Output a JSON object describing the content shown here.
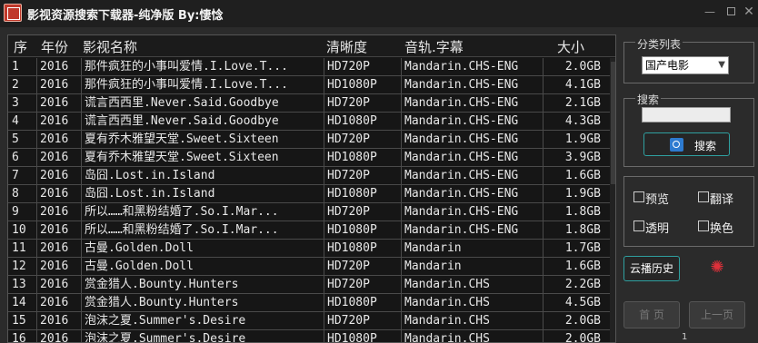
{
  "window": {
    "title": "影视资源搜索下载器-纯净版 By:悽惗",
    "minimize_label": "—",
    "close_label": "✕"
  },
  "table": {
    "headers": [
      "序",
      "年份",
      "影视名称",
      "清晰度",
      "音轨.字幕",
      "大小"
    ],
    "rows": [
      [
        "1",
        "2016",
        "那件疯狂的小事叫爱情.I.Love.T...",
        "HD720P",
        "Mandarin.CHS-ENG",
        "2.0GB"
      ],
      [
        "2",
        "2016",
        "那件疯狂的小事叫爱情.I.Love.T...",
        "HD1080P",
        "Mandarin.CHS-ENG",
        "4.1GB"
      ],
      [
        "3",
        "2016",
        "谎言西西里.Never.Said.Goodbye",
        "HD720P",
        "Mandarin.CHS-ENG",
        "2.1GB"
      ],
      [
        "4",
        "2016",
        "谎言西西里.Never.Said.Goodbye",
        "HD1080P",
        "Mandarin.CHS-ENG",
        "4.3GB"
      ],
      [
        "5",
        "2016",
        "夏有乔木雅望天堂.Sweet.Sixteen",
        "HD720P",
        "Mandarin.CHS-ENG",
        "1.9GB"
      ],
      [
        "6",
        "2016",
        "夏有乔木雅望天堂.Sweet.Sixteen",
        "HD1080P",
        "Mandarin.CHS-ENG",
        "3.9GB"
      ],
      [
        "7",
        "2016",
        "岛囧.Lost.in.Island",
        "HD720P",
        "Mandarin.CHS-ENG",
        "1.6GB"
      ],
      [
        "8",
        "2016",
        "岛囧.Lost.in.Island",
        "HD1080P",
        "Mandarin.CHS-ENG",
        "1.9GB"
      ],
      [
        "9",
        "2016",
        "所以……和黑粉结婚了.So.I.Mar...",
        "HD720P",
        "Mandarin.CHS-ENG",
        "1.8GB"
      ],
      [
        "10",
        "2016",
        "所以……和黑粉结婚了.So.I.Mar...",
        "HD1080P",
        "Mandarin.CHS-ENG",
        "1.8GB"
      ],
      [
        "11",
        "2016",
        "古曼.Golden.Doll",
        "HD1080P",
        "Mandarin",
        "1.7GB"
      ],
      [
        "12",
        "2016",
        "古曼.Golden.Doll",
        "HD720P",
        "Mandarin",
        "1.6GB"
      ],
      [
        "13",
        "2016",
        "赏金猎人.Bounty.Hunters",
        "HD720P",
        "Mandarin.CHS",
        "2.2GB"
      ],
      [
        "14",
        "2016",
        "赏金猎人.Bounty.Hunters",
        "HD1080P",
        "Mandarin.CHS",
        "4.5GB"
      ],
      [
        "15",
        "2016",
        "泡沫之夏.Summer's.Desire",
        "HD720P",
        "Mandarin.CHS",
        "2.0GB"
      ],
      [
        "16",
        "2016",
        "泡沫之夏.Summer's.Desire",
        "HD1080P",
        "Mandarin.CHS",
        "2.0GB"
      ]
    ]
  },
  "category": {
    "label": "分类列表",
    "selected": "国产电影"
  },
  "search": {
    "label": "搜索",
    "value": "",
    "button_label": "搜索"
  },
  "options": {
    "preview": "预览",
    "translate": "翻译",
    "transparent": "透明",
    "skin": "换色"
  },
  "cloud_history_label": "云播历史",
  "pager": {
    "first_label": "首 页",
    "prev_label": "上一页",
    "page": "1"
  },
  "colors": {
    "background": "#2b2b2b",
    "list_background": "#161616",
    "accent_border": "#2fa0a0",
    "gear": "#e0303a"
  },
  "icons": {
    "app": "app-logo-icon",
    "search": "magnifier-icon",
    "settings": "gear-icon"
  }
}
